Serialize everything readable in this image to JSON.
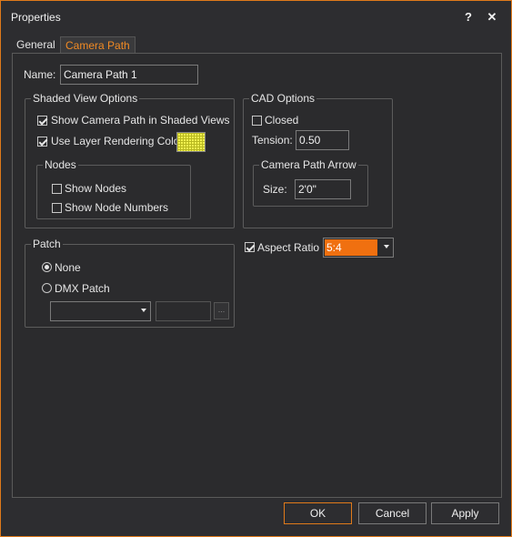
{
  "window": {
    "title": "Properties",
    "help_label": "?",
    "close_label": "✕"
  },
  "tabs": [
    {
      "label": "General",
      "active": false
    },
    {
      "label": "Camera Path",
      "active": true
    }
  ],
  "name": {
    "label": "Name:",
    "value": "Camera Path 1"
  },
  "shaded_view_options": {
    "title": "Shaded View Options",
    "show_camera_path": {
      "label": "Show Camera Path in Shaded Views",
      "checked": true
    },
    "use_layer_color": {
      "label": "Use Layer Rendering Color",
      "checked": true,
      "swatch_color": "#f5f550"
    },
    "nodes": {
      "title": "Nodes",
      "show_nodes": {
        "label": "Show Nodes",
        "checked": false
      },
      "show_node_numbers": {
        "label": "Show Node Numbers",
        "checked": false
      }
    }
  },
  "cad_options": {
    "title": "CAD Options",
    "closed": {
      "label": "Closed",
      "checked": false
    },
    "tension": {
      "label": "Tension:",
      "value": "0.50"
    },
    "arrow": {
      "title": "Camera Path Arrow",
      "size_label": "Size:",
      "size_value": "2'0\""
    }
  },
  "patch": {
    "title": "Patch",
    "none": {
      "label": "None",
      "selected": true
    },
    "dmx": {
      "label": "DMX Patch",
      "selected": false
    },
    "dropdown_value": "",
    "field_value": "",
    "browse_label": "..."
  },
  "aspect_ratio": {
    "label": "Aspect Ratio",
    "checked": true,
    "value": "5:4",
    "accent": "#f07010"
  },
  "footer": {
    "ok_label": "OK",
    "cancel_label": "Cancel",
    "apply_label": "Apply"
  },
  "colors": {
    "accent": "#e07a1a",
    "tab_active": "#f08a24"
  }
}
